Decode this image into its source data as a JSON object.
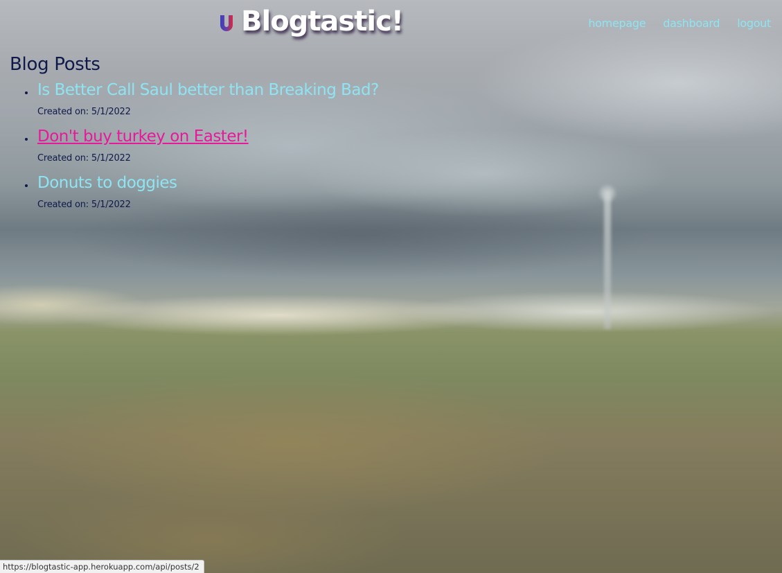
{
  "header": {
    "title": "Blogtastic!",
    "logo_icon": "magnet-icon",
    "nav": [
      {
        "label": "homepage"
      },
      {
        "label": "dashboard"
      },
      {
        "label": "logout"
      }
    ]
  },
  "main": {
    "heading": "Blog Posts",
    "posts": [
      {
        "title": "Is Better Call Saul better than Breaking Bad?",
        "created": "Created on: 5/1/2022"
      },
      {
        "title": "Don't buy turkey on Easter!",
        "created": "Created on: 5/1/2022",
        "hovered": true
      },
      {
        "title": "Donuts to doggies",
        "created": "Created on: 5/1/2022"
      }
    ]
  },
  "status_bar": {
    "url": "https://blogtastic-app.herokuapp.com/api/posts/2"
  },
  "colors": {
    "link": "#8ee4f2",
    "link_hover": "#e8189a",
    "text_dark": "#0f1a4a"
  }
}
